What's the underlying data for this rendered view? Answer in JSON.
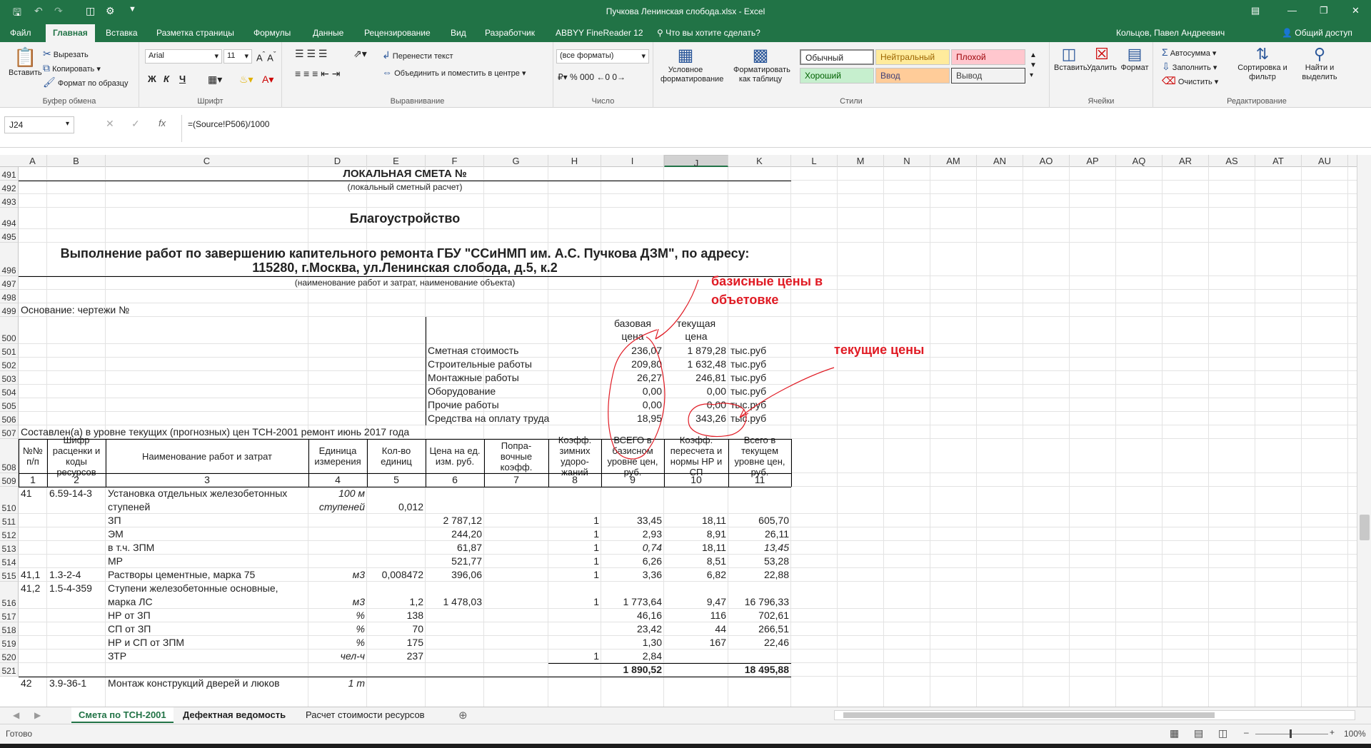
{
  "window": {
    "title": "Пучкова Ленинская слобода.xlsx - Excel"
  },
  "ribbon_tabs": [
    "Файл",
    "Главная",
    "Вставка",
    "Разметка страницы",
    "Формулы",
    "Данные",
    "Рецензирование",
    "Вид",
    "Разработчик",
    "ABBYY FineReader 12"
  ],
  "tell_me": "Что вы хотите сделать?",
  "user": "Кольцов, Павел Андреевич",
  "share": "Общий доступ",
  "ribbon": {
    "clipboard": {
      "paste": "Вставить",
      "cut": "Вырезать",
      "copy": "Копировать",
      "format_painter": "Формат по образцу",
      "label": "Буфер обмена"
    },
    "font": {
      "name": "Arial",
      "size": "11",
      "label": "Шрифт",
      "bold": "Ж",
      "italic": "К",
      "underline": "Ч"
    },
    "alignment": {
      "wrap": "Перенести текст",
      "merge": "Объединить и поместить в центре",
      "label": "Выравнивание"
    },
    "number": {
      "format": "(все форматы)",
      "label": "Число"
    },
    "styles": {
      "conditional": "Условное форматирование",
      "as_table": "Форматировать как таблицу",
      "normal": "Обычный",
      "neutral": "Нейтральный",
      "bad": "Плохой",
      "good": "Хороший",
      "input": "Ввод",
      "output": "Вывод",
      "label": "Стили"
    },
    "cells": {
      "insert": "Вставить",
      "delete": "Удалить",
      "format": "Формат",
      "label": "Ячейки"
    },
    "editing": {
      "autosum": "Автосумма",
      "fill": "Заполнить",
      "clear": "Очистить",
      "sort": "Сортировка и фильтр",
      "find": "Найти и выделить",
      "label": "Редактирование"
    }
  },
  "formula_bar": {
    "namebox": "J24",
    "formula": "=(Source!P506)/1000",
    "fx": "fx"
  },
  "columns": [
    "A",
    "B",
    "C",
    "D",
    "E",
    "F",
    "G",
    "H",
    "I",
    "J",
    "K",
    "L",
    "M",
    "N",
    "AM",
    "AN",
    "AO",
    "AP",
    "AQ",
    "AR",
    "AS",
    "AT",
    "AU"
  ],
  "rows": [
    "491",
    "492",
    "493",
    "494",
    "495",
    "496",
    "497",
    "498",
    "499",
    "500",
    "501",
    "502",
    "503",
    "504",
    "505",
    "506",
    "507",
    "508",
    "509",
    "510",
    "511",
    "512",
    "513",
    "514",
    "515",
    "516",
    "517",
    "518",
    "519",
    "520",
    "521"
  ],
  "header": {
    "title": "ЛОКАЛЬНАЯ СМЕТА №",
    "subtitle": "(локальный сметный расчет)",
    "section": "Благоустройство",
    "work_line1": "Выполнение работ по завершению капительного ремонта ГБУ \"ССиНМП им. А.С. Пучкова ДЗМ\", по адресу:",
    "work_line2": "115280, г.Москва, ул.Ленинская слобода, д.5, к.2",
    "work_caption": "(наименование работ и затрат, наименование объекта)",
    "basis": "Основание: чертежи №",
    "base_price_h": "базовая цена",
    "current_price_h": "текущая цена",
    "compiled": "Составлен(а) в уровне текущих (прогнозных) цен ТСН-2001 ремонт июнь 2017 года"
  },
  "summary": [
    {
      "label": "Сметная стоимость",
      "base": "236,07",
      "current": "1 879,28",
      "unit": "тыс.руб"
    },
    {
      "label": "Строительные работы",
      "base": "209,80",
      "current": "1 632,48",
      "unit": "тыс.руб"
    },
    {
      "label": "Монтажные работы",
      "base": "26,27",
      "current": "246,81",
      "unit": "тыс.руб"
    },
    {
      "label": "Оборудование",
      "base": "0,00",
      "current": "0,00",
      "unit": "тыс.руб"
    },
    {
      "label": "Прочие работы",
      "base": "0,00",
      "current": "0,00",
      "unit": "тыс.руб"
    },
    {
      "label": "Средства на оплату труда",
      "base": "18,95",
      "current": "343,26",
      "unit": "тыс.руб"
    }
  ],
  "table_headers": [
    "№№ п/п",
    "Шифр расценки и коды ресурсов",
    "Наименование работ и затрат",
    "Единица измерения",
    "Кол-во единиц",
    "Цена на ед. изм. руб.",
    "Попра- вочные коэфф.",
    "Коэфф. зимних удоро- жаний",
    "ВСЕГО в базисном уровне цен, руб.",
    "Коэфф. пересчета и нормы НР и СП",
    "Всего в текущем уровне цен, руб."
  ],
  "table_nums": [
    "1",
    "2",
    "3",
    "4",
    "5",
    "6",
    "7",
    "8",
    "9",
    "10",
    "11"
  ],
  "table_rows": [
    {
      "a": "41",
      "b": "6.59-14-3",
      "c": "Установка отдельных железобетонных",
      "d": "100 м",
      "e": "",
      "f": "",
      "h": "",
      "i": "",
      "j": "",
      "k": ""
    },
    {
      "a": "",
      "b": "",
      "c": "ступеней",
      "d": "ступеней",
      "e": "0,012",
      "f": "",
      "h": "",
      "i": "",
      "j": "",
      "k": ""
    },
    {
      "a": "",
      "b": "",
      "c": "ЗП",
      "d": "",
      "e": "",
      "f": "2 787,12",
      "h": "1",
      "i": "33,45",
      "j": "18,11",
      "k": "605,70"
    },
    {
      "a": "",
      "b": "",
      "c": "ЭМ",
      "d": "",
      "e": "",
      "f": "244,20",
      "h": "1",
      "i": "2,93",
      "j": "8,91",
      "k": "26,11"
    },
    {
      "a": "",
      "b": "",
      "c": "в т.ч. ЗПМ",
      "d": "",
      "e": "",
      "f": "61,87",
      "h": "1",
      "i": "0,74",
      "j": "18,11",
      "k": "13,45"
    },
    {
      "a": "",
      "b": "",
      "c": "МР",
      "d": "",
      "e": "",
      "f": "521,77",
      "h": "1",
      "i": "6,26",
      "j": "8,51",
      "k": "53,28"
    },
    {
      "a": "41,1",
      "b": "1.3-2-4",
      "c": "Растворы цементные, марка 75",
      "d": "м3",
      "e": "0,008472",
      "f": "396,06",
      "h": "1",
      "i": "3,36",
      "j": "6,82",
      "k": "22,88"
    },
    {
      "a": "41,2",
      "b": "1.5-4-359",
      "c": "Ступени железобетонные основные,",
      "d": "",
      "e": "",
      "f": "",
      "h": "",
      "i": "",
      "j": "",
      "k": ""
    },
    {
      "a": "",
      "b": "",
      "c": "марка ЛС",
      "d": "м3",
      "e": "1,2",
      "f": "1 478,03",
      "h": "1",
      "i": "1 773,64",
      "j": "9,47",
      "k": "16 796,33"
    },
    {
      "a": "",
      "b": "",
      "c": "НР от ЗП",
      "d": "%",
      "e": "138",
      "f": "",
      "h": "",
      "i": "46,16",
      "j": "116",
      "k": "702,61"
    },
    {
      "a": "",
      "b": "",
      "c": "СП от ЗП",
      "d": "%",
      "e": "70",
      "f": "",
      "h": "",
      "i": "23,42",
      "j": "44",
      "k": "266,51"
    },
    {
      "a": "",
      "b": "",
      "c": "НР и СП от ЗПМ",
      "d": "%",
      "e": "175",
      "f": "",
      "h": "",
      "i": "1,30",
      "j": "167",
      "k": "22,46"
    },
    {
      "a": "",
      "b": "",
      "c": "ЗТР",
      "d": "чел-ч",
      "e": "237",
      "f": "",
      "h": "1",
      "i": "2,84",
      "j": "",
      "k": ""
    },
    {
      "a": "",
      "b": "",
      "c": "",
      "d": "",
      "e": "",
      "f": "",
      "h": "",
      "i": "1 890,52",
      "j": "",
      "k": "18 495,88"
    },
    {
      "a": "42",
      "b": "3.9-36-1",
      "c": "Монтаж конструкций дверей и люков",
      "d": "1 т",
      "e": "",
      "f": "",
      "h": "",
      "i": "",
      "j": "",
      "k": ""
    }
  ],
  "annotations": {
    "base_note_1": "базисные цены в",
    "base_note_2": "объетовке",
    "current_note": "текущие цены"
  },
  "sheet_tabs": [
    "Смета по ТСН-2001",
    "Дефектная ведомость",
    "Расчет стоимости ресурсов"
  ],
  "status": {
    "ready": "Готово",
    "zoom": "100%"
  },
  "colors": {
    "excel_green": "#217346",
    "annotation_red": "#e01b24"
  }
}
